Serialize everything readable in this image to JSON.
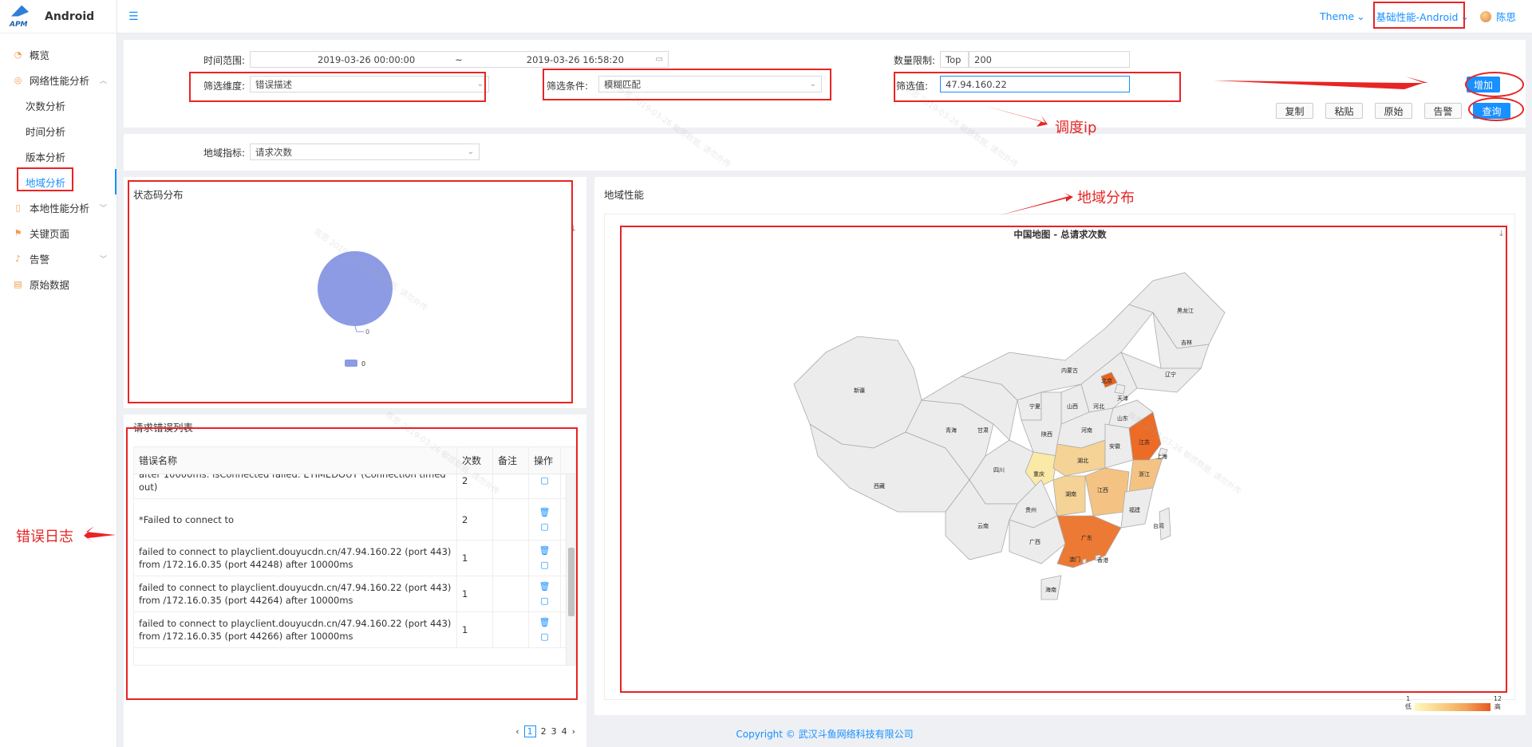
{
  "brand": {
    "logo_text": "APM",
    "name": "Android"
  },
  "sidebar": {
    "items": [
      {
        "label": "概览",
        "icon": "dashboard-icon"
      },
      {
        "label": "网络性能分析",
        "icon": "globe-icon"
      },
      {
        "label": "次数分析"
      },
      {
        "label": "时间分析"
      },
      {
        "label": "版本分析"
      },
      {
        "label": "地域分析"
      },
      {
        "label": "本地性能分析",
        "icon": "phone-icon"
      },
      {
        "label": "关键页面",
        "icon": "flag-icon"
      },
      {
        "label": "告警",
        "icon": "bell-icon"
      },
      {
        "label": "原始数据",
        "icon": "database-icon"
      }
    ]
  },
  "header": {
    "theme": "Theme",
    "module": "基础性能-Android",
    "user": "陈思"
  },
  "filters": {
    "time_label": "时间范围:",
    "time_start": "2019-03-26 00:00:00",
    "time_sep": "~",
    "time_end": "2019-03-26 16:58:20",
    "limit_label": "数量限制:",
    "limit_prefix": "Top",
    "limit_value": "200",
    "dimension_label": "筛选维度:",
    "dimension_value": "错误描述",
    "condition_label": "筛选条件:",
    "condition_value": "模糊匹配",
    "value_label": "筛选值:",
    "value_value": "47.94.160.22",
    "add_button": "增加",
    "copy_button": "复制",
    "paste_button": "粘贴",
    "original_button": "原始",
    "alarm_button": "告警",
    "query_button": "查询"
  },
  "region_metric": {
    "label": "地域指标:",
    "value": "请求次数"
  },
  "status_panel": {
    "title": "状态码分布",
    "pie_label": "0",
    "legend": "0"
  },
  "errors_panel": {
    "title": "请求错误列表",
    "columns": [
      "错误名称",
      "次数",
      "备注",
      "操作"
    ],
    "rows": [
      {
        "name": "after 10000ms: isConnected failed: ETIMEDOUT (Connection timed out)",
        "count": "2"
      },
      {
        "name": "*Failed to connect to",
        "count": "2"
      },
      {
        "name": "failed to connect to playclient.douyucdn.cn/47.94.160.22 (port 443) from /172.16.0.35 (port 44248) after 10000ms",
        "count": "1"
      },
      {
        "name": "failed to connect to playclient.douyucdn.cn/47.94.160.22 (port 443) from /172.16.0.35 (port 44264) after 10000ms",
        "count": "1"
      },
      {
        "name": "failed to connect to playclient.douyucdn.cn/47.94.160.22 (port 443) from /172.16.0.35 (port 44266) after 10000ms",
        "count": "1"
      }
    ],
    "pages": [
      "1",
      "2",
      "3",
      "4"
    ]
  },
  "geo_panel": {
    "title": "地域性能",
    "map_title": "中国地图 - 总请求次数",
    "legend_min": "1",
    "legend_max": "12",
    "legend_low": "低",
    "legend_high": "高",
    "provinces": [
      {
        "name": "新疆"
      },
      {
        "name": "西藏"
      },
      {
        "name": "青海"
      },
      {
        "name": "甘肃"
      },
      {
        "name": "内蒙古"
      },
      {
        "name": "黑龙江"
      },
      {
        "name": "吉林"
      },
      {
        "name": "辽宁"
      },
      {
        "name": "北京",
        "level": "high"
      },
      {
        "name": "天津"
      },
      {
        "name": "河北"
      },
      {
        "name": "山西"
      },
      {
        "name": "宁夏"
      },
      {
        "name": "陕西"
      },
      {
        "name": "山东"
      },
      {
        "name": "河南"
      },
      {
        "name": "四川"
      },
      {
        "name": "重庆",
        "level": "low"
      },
      {
        "name": "湖北",
        "level": "low-mid"
      },
      {
        "name": "安徽"
      },
      {
        "name": "江苏",
        "level": "high"
      },
      {
        "name": "上海"
      },
      {
        "name": "浙江",
        "level": "mid"
      },
      {
        "name": "湖南",
        "level": "low-mid"
      },
      {
        "name": "江西",
        "level": "mid"
      },
      {
        "name": "福建"
      },
      {
        "name": "台湾"
      },
      {
        "name": "贵州"
      },
      {
        "name": "云南"
      },
      {
        "name": "广西"
      },
      {
        "name": "广东",
        "level": "high"
      },
      {
        "name": "香港"
      },
      {
        "name": "澳门"
      },
      {
        "name": "海南"
      }
    ]
  },
  "annotations": {
    "ip": "调度ip",
    "region": "地域分布",
    "error_log": "错误日志"
  },
  "watermark": "陈思 2019-03-26 敏感数据, 请勿外传",
  "footer": "Copyright © 武汉斗鱼网络科技有限公司",
  "colors": {
    "accent": "#1890ff",
    "annotation": "#e82424",
    "pie": "#8c9be3"
  }
}
